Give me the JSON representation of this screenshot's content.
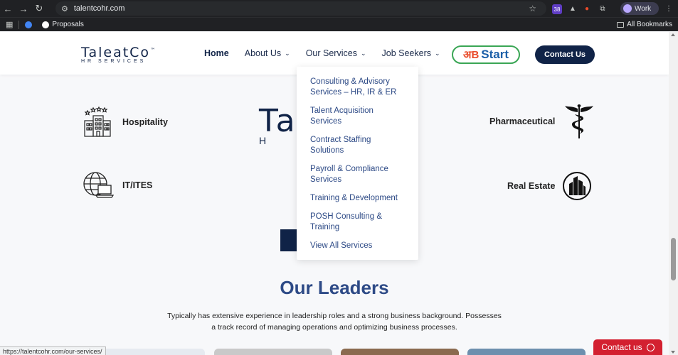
{
  "browser": {
    "url": "talentcohr.com",
    "status_url": "https://talentcohr.com/our-services/",
    "profile": "Work",
    "extension_badge": "38",
    "bookmarks": [
      {
        "label": "Proposals"
      }
    ],
    "all_bookmarks": "All Bookmarks"
  },
  "header": {
    "logo_main": "TaleatCo",
    "logo_tm": "™",
    "logo_sub": "HR SERVICES",
    "nav": [
      {
        "label": "Home"
      },
      {
        "label": "About Us"
      },
      {
        "label": "Our Services"
      },
      {
        "label": "Job Seekers"
      }
    ],
    "ab_start_hi": "अB",
    "ab_start": "Start",
    "contact_label": "Contact Us"
  },
  "dropdown": {
    "items": [
      {
        "label": "Consulting & Advisory Services – HR, IR & ER"
      },
      {
        "label": "Talent Acquisition Services"
      },
      {
        "label": "Contract Staffing Solutions"
      },
      {
        "label": "Payroll & Compliance Services"
      },
      {
        "label": "Training & Development"
      },
      {
        "label": "POSH Consulting & Training"
      },
      {
        "label": "View All Services"
      }
    ]
  },
  "industries": {
    "hospitality": "Hospitality",
    "pharmaceutical": "Pharmaceutical",
    "it": "IT/ITES",
    "real_estate": "Real Estate"
  },
  "center_logo": {
    "big": "Ta",
    "small": "H R"
  },
  "leaders": {
    "title": "Our Leaders",
    "text": "Typically has extensive experience in leadership roles and a strong business background. Possesses a track record of managing operations and optimizing business processes."
  },
  "float_contact": "Contact us",
  "colors": {
    "navy": "#102347",
    "accent_blue": "#2d4a86",
    "contact_red": "#d32030"
  }
}
